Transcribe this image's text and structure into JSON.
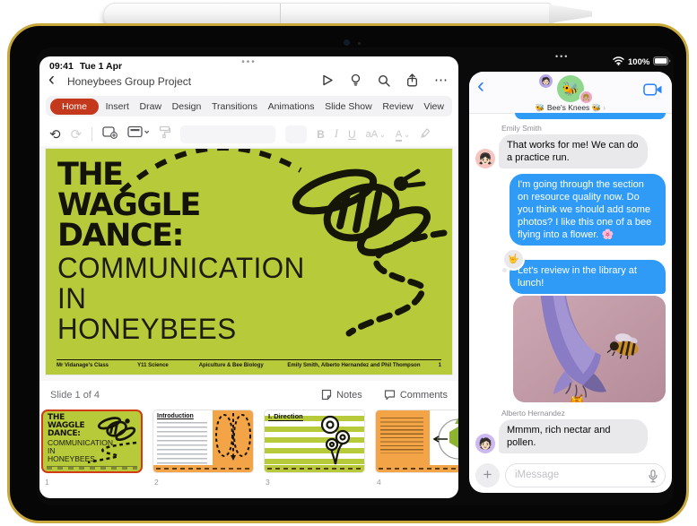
{
  "status": {
    "time": "09:41",
    "date": "Tue 1 Apr",
    "battery": "100%",
    "handle_dots": "•••"
  },
  "powerpoint": {
    "nav": {
      "back": "‹",
      "title": "Honeybees Group Project",
      "more_dots": "⋯"
    },
    "tabs": {
      "home": "Home",
      "insert": "Insert",
      "draw": "Draw",
      "design": "Design",
      "transitions": "Transitions",
      "animations": "Animations",
      "slideshow": "Slide Show",
      "review": "Review",
      "view": "View"
    },
    "toolbar": {
      "undo": "⟲",
      "redo": "⟳",
      "bold": "B",
      "italic": "I",
      "underline": "U",
      "textsize": "aA",
      "fontcolor": "A",
      "chevron": "⌄"
    },
    "slide": {
      "title1": "THE",
      "title2": "WAGGLE",
      "title3": "DANCE:",
      "sub1": "COMMUNICATION",
      "sub2": "IN",
      "sub3": "HONEYBEES",
      "footer1": "Mr Vidanage's Class",
      "footer2": "Y11 Science",
      "footer3": "Apiculture & Bee Biology",
      "footer4": "Emily Smith, Alberto Hernandez and Phil Thompson",
      "page_number": "1"
    },
    "statusbar": {
      "slide_label": "Slide 1 of 4",
      "notes": "Notes",
      "comments": "Comments"
    },
    "thumbs": {
      "n1": "1",
      "n2": "2",
      "n3": "3",
      "n4": "4",
      "t2_heading": "Introduction",
      "t3_heading": "I. Direction"
    }
  },
  "messages": {
    "header": {
      "back": "‹",
      "group_name": "🐝 Bee's Knees 🐝",
      "detail_chevron": "›",
      "group_avatar_emoji": "🐝",
      "member_top_emoji": "🧑🏻",
      "member_bottom_emoji": "👧🏼"
    },
    "chat": {
      "sender1": "Emily Smith",
      "msg1": "That works for me! We can do a practice run.",
      "msg2": "I'm going through the section on resource quality now. Do you think we should add some photos? I like this one of a bee flying into a flower. 🌸",
      "reaction_emoji": "🤟",
      "msg3": "Let's review in the library at lunch!",
      "honey_emoji": "🍯",
      "sender2": "Alberto Hernandez",
      "msg4": "Mmmm, rich nectar and pollen.",
      "avatar1_emoji": "👧🏻",
      "avatar2_emoji": "🧑🏻"
    },
    "input": {
      "plus": "+",
      "placeholder": "iMessage"
    }
  },
  "colors": {
    "accent_blue": "#2f9bf7",
    "ppt_red": "#c4391d",
    "slide_green": "#b7cb3a",
    "thumb_orange": "#f3a447",
    "device_yellow": "#c9a83c"
  }
}
